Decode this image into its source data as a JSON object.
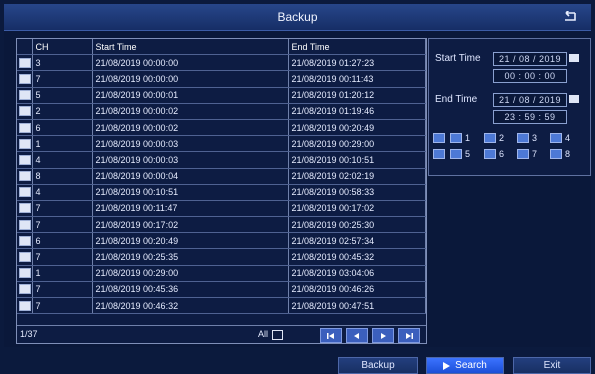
{
  "window": {
    "title": "Backup"
  },
  "table": {
    "headers": {
      "ch": "CH",
      "start": "Start Time",
      "end": "End Time"
    },
    "rows": [
      {
        "ch": "3",
        "start": "21/08/2019 00:00:00",
        "end": "21/08/2019 01:27:23"
      },
      {
        "ch": "7",
        "start": "21/08/2019 00:00:00",
        "end": "21/08/2019 00:11:43"
      },
      {
        "ch": "5",
        "start": "21/08/2019 00:00:01",
        "end": "21/08/2019 01:20:12"
      },
      {
        "ch": "2",
        "start": "21/08/2019 00:00:02",
        "end": "21/08/2019 01:19:46"
      },
      {
        "ch": "6",
        "start": "21/08/2019 00:00:02",
        "end": "21/08/2019 00:20:49"
      },
      {
        "ch": "1",
        "start": "21/08/2019 00:00:03",
        "end": "21/08/2019 00:29:00"
      },
      {
        "ch": "4",
        "start": "21/08/2019 00:00:03",
        "end": "21/08/2019 00:10:51"
      },
      {
        "ch": "8",
        "start": "21/08/2019 00:00:04",
        "end": "21/08/2019 02:02:19"
      },
      {
        "ch": "4",
        "start": "21/08/2019 00:10:51",
        "end": "21/08/2019 00:58:33"
      },
      {
        "ch": "7",
        "start": "21/08/2019 00:11:47",
        "end": "21/08/2019 00:17:02"
      },
      {
        "ch": "7",
        "start": "21/08/2019 00:17:02",
        "end": "21/08/2019 00:25:30"
      },
      {
        "ch": "6",
        "start": "21/08/2019 00:20:49",
        "end": "21/08/2019 02:57:34"
      },
      {
        "ch": "7",
        "start": "21/08/2019 00:25:35",
        "end": "21/08/2019 00:45:32"
      },
      {
        "ch": "1",
        "start": "21/08/2019 00:29:00",
        "end": "21/08/2019 03:04:06"
      },
      {
        "ch": "7",
        "start": "21/08/2019 00:45:36",
        "end": "21/08/2019 00:46:26"
      },
      {
        "ch": "7",
        "start": "21/08/2019 00:46:32",
        "end": "21/08/2019 00:47:51"
      }
    ]
  },
  "footer": {
    "page": "1/37",
    "all_label": "All"
  },
  "filter": {
    "start_label": "Start Time",
    "start_date": "21 / 08 / 2019",
    "start_time": "00 : 00 : 00",
    "end_label": "End Time",
    "end_date": "21 / 08 / 2019",
    "end_time": "23 : 59 : 59"
  },
  "channels": [
    "1",
    "2",
    "3",
    "4",
    "5",
    "6",
    "7",
    "8"
  ],
  "buttons": {
    "backup": "Backup",
    "search": "Search",
    "exit": "Exit"
  },
  "colors": {
    "background": "#0b1a3d",
    "accent": "#2f67ff"
  },
  "icons": [
    "back-arrow-icon",
    "calendar-icon",
    "first-page-icon",
    "prev-page-icon",
    "next-page-icon",
    "last-page-icon",
    "pointer-cursor-icon"
  ]
}
